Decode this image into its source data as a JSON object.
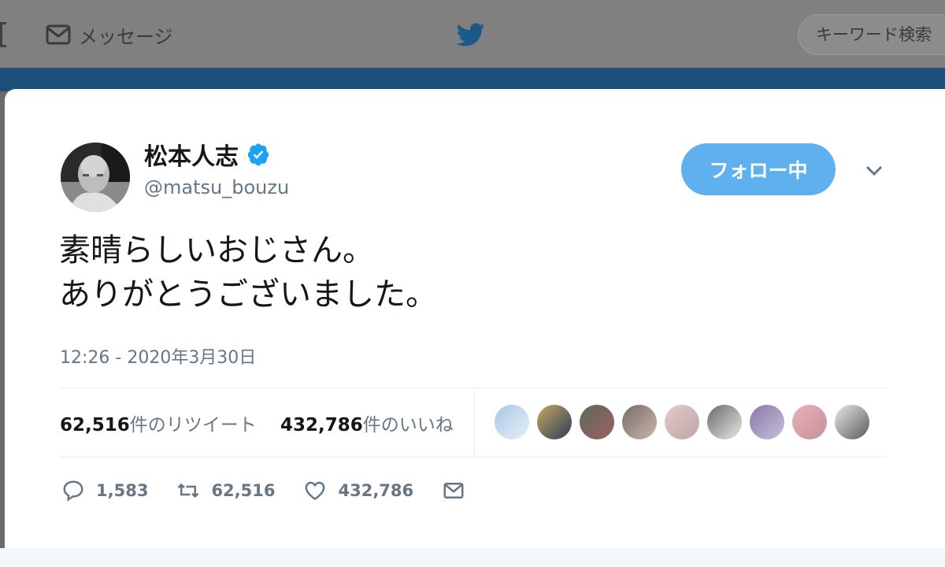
{
  "nav": {
    "messages_label": "メッセージ",
    "search_placeholder": "キーワード検索"
  },
  "tweet": {
    "author": {
      "name": "松本人志",
      "handle": "@matsu_bouzu",
      "verified": true
    },
    "follow_button_label": "フォロー中",
    "text_lines": [
      "素晴らしいおじさん。",
      "ありがとうございました。"
    ],
    "timestamp": "12:26 - 2020年3月30日",
    "stats": {
      "retweets_count": "62,516",
      "retweets_label": "件のリツイート",
      "likes_count": "432,786",
      "likes_label": "件のいいね"
    },
    "actions": {
      "replies": "1,583",
      "retweets": "62,516",
      "likes": "432,786"
    }
  },
  "colors": {
    "twitter_blue": "#1da1f2",
    "follow_button": "#5fb0ef",
    "secondary_text": "#657786",
    "banner": "#1b4f7a"
  },
  "icons": [
    "envelope-icon",
    "twitter-bird-icon",
    "verified-badge-icon",
    "chevron-down-icon",
    "reply-icon",
    "retweet-icon",
    "like-heart-icon",
    "direct-message-icon"
  ]
}
